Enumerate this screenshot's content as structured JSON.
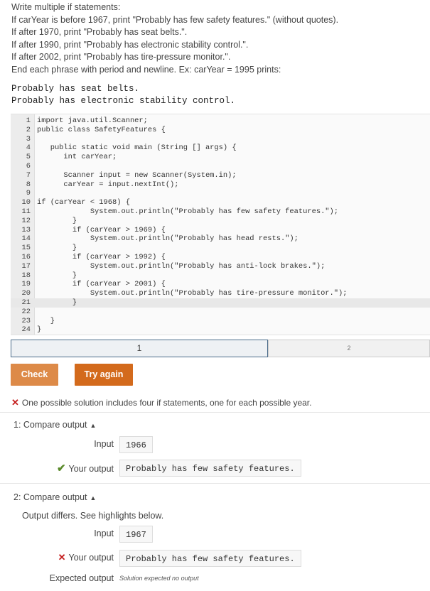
{
  "instructions": [
    "Write multiple if statements:",
    "If carYear is before 1967, print \"Probably has few safety features.\" (without quotes).",
    "If after 1970, print \"Probably has seat belts.\".",
    "If after 1990, print \"Probably has electronic stability control.\".",
    "If after 2002, print \"Probably has tire-pressure monitor.\".",
    "End each phrase with period and newline. Ex: carYear = 1995 prints:"
  ],
  "example_output": [
    "Probably has seat belts.",
    "Probably has electronic stability control."
  ],
  "code_lines": [
    {
      "n": "1",
      "t": "import java.util.Scanner;"
    },
    {
      "n": "2",
      "t": "public class SafetyFeatures {"
    },
    {
      "n": "3",
      "t": ""
    },
    {
      "n": "4",
      "t": "   public static void main (String [] args) {"
    },
    {
      "n": "5",
      "t": "      int carYear;"
    },
    {
      "n": "6",
      "t": ""
    },
    {
      "n": "7",
      "t": "      Scanner input = new Scanner(System.in);"
    },
    {
      "n": "8",
      "t": "      carYear = input.nextInt();"
    },
    {
      "n": "9",
      "t": ""
    },
    {
      "n": "10",
      "t": "if (carYear < 1968) {"
    },
    {
      "n": "11",
      "t": "            System.out.println(\"Probably has few safety features.\");"
    },
    {
      "n": "12",
      "t": "        }"
    },
    {
      "n": "13",
      "t": "        if (carYear > 1969) {"
    },
    {
      "n": "14",
      "t": "            System.out.println(\"Probably has head rests.\");"
    },
    {
      "n": "15",
      "t": "        }"
    },
    {
      "n": "16",
      "t": "        if (carYear > 1992) {"
    },
    {
      "n": "17",
      "t": "            System.out.println(\"Probably has anti-lock brakes.\");"
    },
    {
      "n": "18",
      "t": "        }"
    },
    {
      "n": "19",
      "t": "        if (carYear > 2001) {"
    },
    {
      "n": "20",
      "t": "            System.out.println(\"Probably has tire-pressure monitor.\");"
    },
    {
      "n": "21",
      "t": "        }"
    },
    {
      "n": "22",
      "t": ""
    },
    {
      "n": "23",
      "t": "   }"
    },
    {
      "n": "24",
      "t": "}"
    }
  ],
  "active_line": 21,
  "progress": {
    "step_current": "1",
    "step_next": "2"
  },
  "buttons": {
    "check": "Check",
    "try_again": "Try again"
  },
  "feedback": {
    "x_icon": "✕",
    "message": "One possible solution includes four if statements, one for each possible year."
  },
  "compare1": {
    "title": "1: Compare output",
    "input_label": "Input",
    "input_value": "1966",
    "your_output_icon": "✔",
    "your_output_label": "Your output",
    "your_output_value": "Probably has few safety features."
  },
  "compare2": {
    "title": "2: Compare output",
    "note": "Output differs. See highlights below.",
    "input_label": "Input",
    "input_value": "1967",
    "your_output_icon": "✕",
    "your_output_label": "Your output",
    "your_output_value": "Probably has few safety features.",
    "expected_label": "Expected output",
    "expected_value": "Solution expected no output"
  },
  "colors": {
    "check_button": "#dd8a48",
    "try_button": "#d36a1c",
    "error": "#c41e1e",
    "success": "#5a8a2a"
  }
}
